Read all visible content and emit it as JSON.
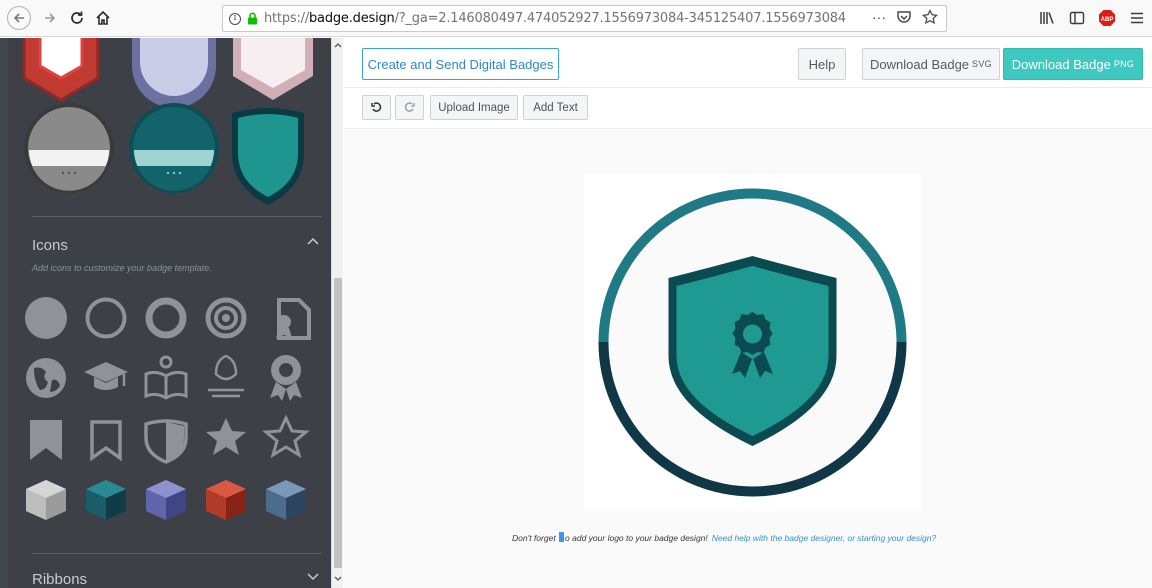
{
  "browser": {
    "url_prefix": "https://",
    "url_domain": "badge.design",
    "url_path": "/?_ga=2.146080497.474052927.1556973084-345125407.1556973084",
    "more_label": "···",
    "abp_label": "ABP",
    "info_label": "i"
  },
  "sidebar": {
    "icons_section": {
      "title": "Icons",
      "subtitle": "Add icons to customize your badge template."
    },
    "ribbons_section": {
      "title": "Ribbons"
    },
    "icons": [
      "filled-circle-icon",
      "circle-outline-icon",
      "thick-circle-icon",
      "target-icon",
      "document-ribbon-icon",
      "globe-icon",
      "graduation-cap-icon",
      "book-reader-icon",
      "award-laurel-icon",
      "award-ribbon-icon",
      "bookmark-filled-icon",
      "bookmark-outline-icon",
      "shield-half-icon",
      "star-filled-icon",
      "star-outline-icon",
      "gray-cube-icon",
      "teal-cube-icon",
      "purple-cube-icon",
      "red-cube-icon",
      "blue-cube-icon"
    ]
  },
  "header": {
    "create_send_label": "Create and Send Digital Badges",
    "help_label": "Help",
    "download_svg_label": "Download Badge",
    "download_svg_suffix": "SVG",
    "download_png_label": "Download Badge",
    "download_png_suffix": "PNG"
  },
  "editor": {
    "undo_icon": "undo-icon",
    "redo_icon": "redo-icon",
    "upload_image_label": "Upload Image",
    "add_text_label": "Add Text"
  },
  "footer": {
    "note_before": "Don't forget ",
    "note_after": "o add your logo to your badge design!",
    "help_link": "Need help with the badge designer, or starting your design?"
  },
  "colors": {
    "teal_ring": "#1f7a86",
    "dark_ring": "#0f3746",
    "shield_fill": "#1f9a93",
    "shield_border": "#0c4a52",
    "png_button": "#3ec9c0",
    "panel_bg": "#3d4147"
  }
}
